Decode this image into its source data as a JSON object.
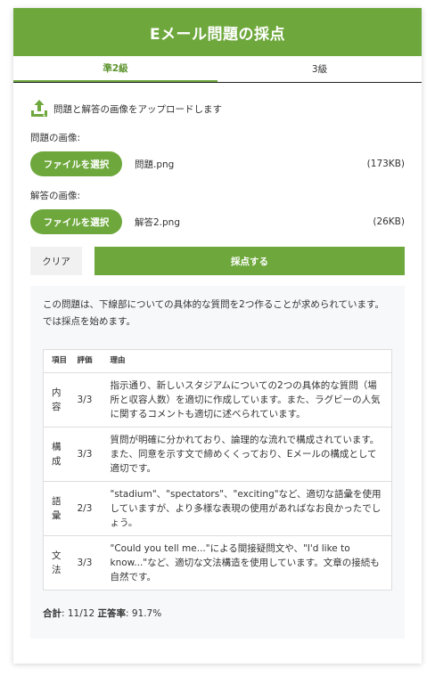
{
  "header": {
    "title": "Eメール問題の採点"
  },
  "tabs": [
    {
      "label": "準2級",
      "active": true
    },
    {
      "label": "3級",
      "active": false
    }
  ],
  "upload": {
    "instruction": "問題と解答の画像をアップロードします"
  },
  "question_file": {
    "label": "問題の画像:",
    "button_label": "ファイルを選択",
    "file_name": "問題.png",
    "file_size": "(173KB)"
  },
  "answer_file": {
    "label": "解答の画像:",
    "button_label": "ファイルを選択",
    "file_name": "解答2.png",
    "file_size": "(26KB)"
  },
  "actions": {
    "clear_label": "クリア",
    "grade_label": "採点する"
  },
  "result": {
    "intro": "この問題は、下線部についての具体的な質問を2つ作ることが求められています。では採点を始めます。",
    "table": {
      "headers": [
        "項目",
        "評価",
        "理由"
      ],
      "rows": [
        {
          "item": "内容",
          "grade": "3/3",
          "reason": "指示通り、新しいスタジアムについての2つの具体的な質問（場所と収容人数）を適切に作成しています。また、ラグビーの人気に関するコメントも適切に述べられています。"
        },
        {
          "item": "構成",
          "grade": "3/3",
          "reason": "質問が明確に分かれており、論理的な流れで構成されています。また、同意を示す文で締めくくっており、Eメールの構成として適切です。"
        },
        {
          "item": "語彙",
          "grade": "2/3",
          "reason": "\"stadium\"、\"spectators\"、\"exciting\"など、適切な語彙を使用していますが、より多様な表現の使用があればなお良かったでしょう。"
        },
        {
          "item": "文法",
          "grade": "3/3",
          "reason": "\"Could you tell me...\"による間接疑問文や、\"I'd like to know...\"など、適切な文法構造を使用しています。文章の接続も自然です。"
        }
      ]
    },
    "total_label": "合計",
    "total_value": ": 11/12 ",
    "accuracy_label": "正答率",
    "accuracy_value": ": 91.7%"
  },
  "colors": {
    "accent": "#6ea83c",
    "panel_bg": "#f7f8fa"
  }
}
